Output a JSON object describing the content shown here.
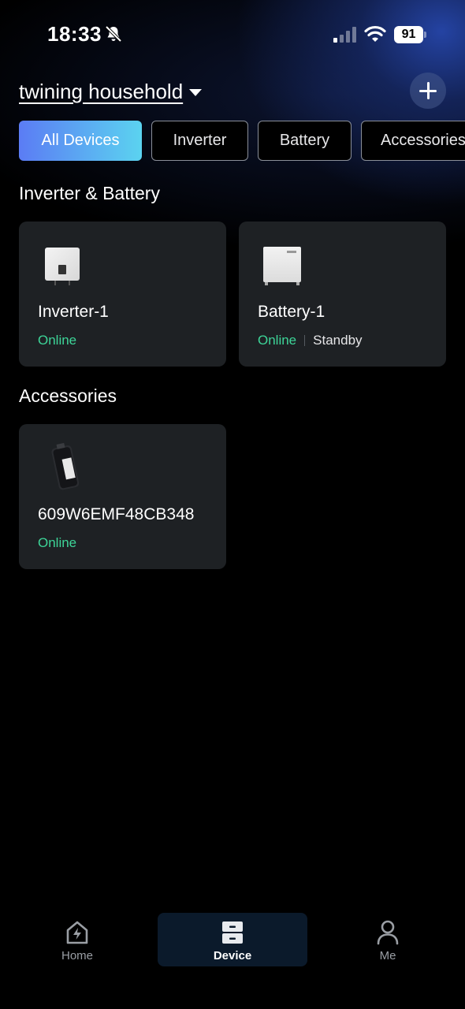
{
  "status_bar": {
    "time": "18:33",
    "battery_level": "91",
    "icons": [
      "bell-slash-icon",
      "cellular-signal-icon",
      "wifi-icon",
      "battery-icon"
    ]
  },
  "header": {
    "household_name": "twining household",
    "add_icon": "plus-icon"
  },
  "tabs": [
    {
      "label": "All Devices",
      "active": true
    },
    {
      "label": "Inverter",
      "active": false
    },
    {
      "label": "Battery",
      "active": false
    },
    {
      "label": "Accessories",
      "active": false
    }
  ],
  "sections": {
    "inverter_battery": {
      "title": "Inverter & Battery",
      "devices": [
        {
          "name": "Inverter-1",
          "status": "Online",
          "icon": "inverter-device-icon"
        },
        {
          "name": "Battery-1",
          "status": "Online",
          "substatus": "Standby",
          "icon": "battery-device-icon"
        }
      ]
    },
    "accessories": {
      "title": "Accessories",
      "devices": [
        {
          "name": "609W6EMF48CB348",
          "status": "Online",
          "icon": "dongle-device-icon"
        }
      ]
    }
  },
  "bottom_nav": [
    {
      "label": "Home",
      "icon": "home-bolt-icon",
      "active": false
    },
    {
      "label": "Device",
      "icon": "device-server-icon",
      "active": true
    },
    {
      "label": "Me",
      "icon": "user-icon",
      "active": false
    }
  ],
  "colors": {
    "accent_gradient_start": "#5b7cf4",
    "accent_gradient_end": "#5bd3f0",
    "online": "#3dd598",
    "card_bg": "#1e2124",
    "background": "#000000"
  }
}
